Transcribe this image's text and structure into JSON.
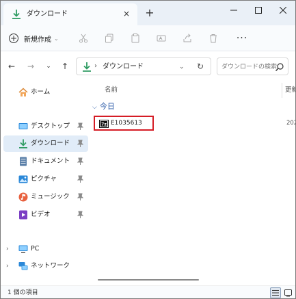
{
  "tab": {
    "title": "ダウンロード",
    "close": "×",
    "new_tab": "+"
  },
  "window_controls": {
    "minimize": "—",
    "maximize": "☐",
    "close": "✕"
  },
  "command_bar": {
    "new_label": "新規作成",
    "new_caret": "⌄",
    "icons": [
      "cut-icon",
      "copy-icon",
      "paste-icon",
      "rename-icon",
      "share-icon",
      "delete-icon"
    ],
    "more": "···"
  },
  "nav": {
    "back": "←",
    "forward": "→",
    "recent": "⌄",
    "up": "↑"
  },
  "address": {
    "separator": "›",
    "current": "ダウンロード",
    "dropdown": "⌄",
    "refresh": "↻"
  },
  "search": {
    "placeholder": "ダウンロードの検索"
  },
  "sidebar": {
    "home": "ホーム",
    "quick_access": [
      {
        "label": "デスクトップ",
        "icon": "desktop-icon"
      },
      {
        "label": "ダウンロード",
        "icon": "download-icon"
      },
      {
        "label": "ドキュメント",
        "icon": "document-icon"
      },
      {
        "label": "ピクチャ",
        "icon": "pictures-icon"
      },
      {
        "label": "ミュージック",
        "icon": "music-icon"
      },
      {
        "label": "ビデオ",
        "icon": "video-icon"
      }
    ],
    "pin_symbol": "📌",
    "tree": [
      {
        "label": "PC",
        "icon": "pc-icon",
        "chevron": "›"
      },
      {
        "label": "ネットワーク",
        "icon": "network-icon",
        "chevron": "›"
      }
    ]
  },
  "content": {
    "columns": {
      "name": "名前",
      "date": "更新"
    },
    "group": {
      "label": "今日",
      "chevron": "⌵"
    },
    "files": [
      {
        "name": "E1035613",
        "date": "202",
        "icon": "7zip-file-icon"
      }
    ]
  },
  "status": {
    "item_count": "1 個の項目"
  },
  "colors": {
    "accent": "#0078d4",
    "highlight_border": "#d51c25",
    "selection": "#e1ecf8",
    "group_header": "#2a5aa7"
  }
}
